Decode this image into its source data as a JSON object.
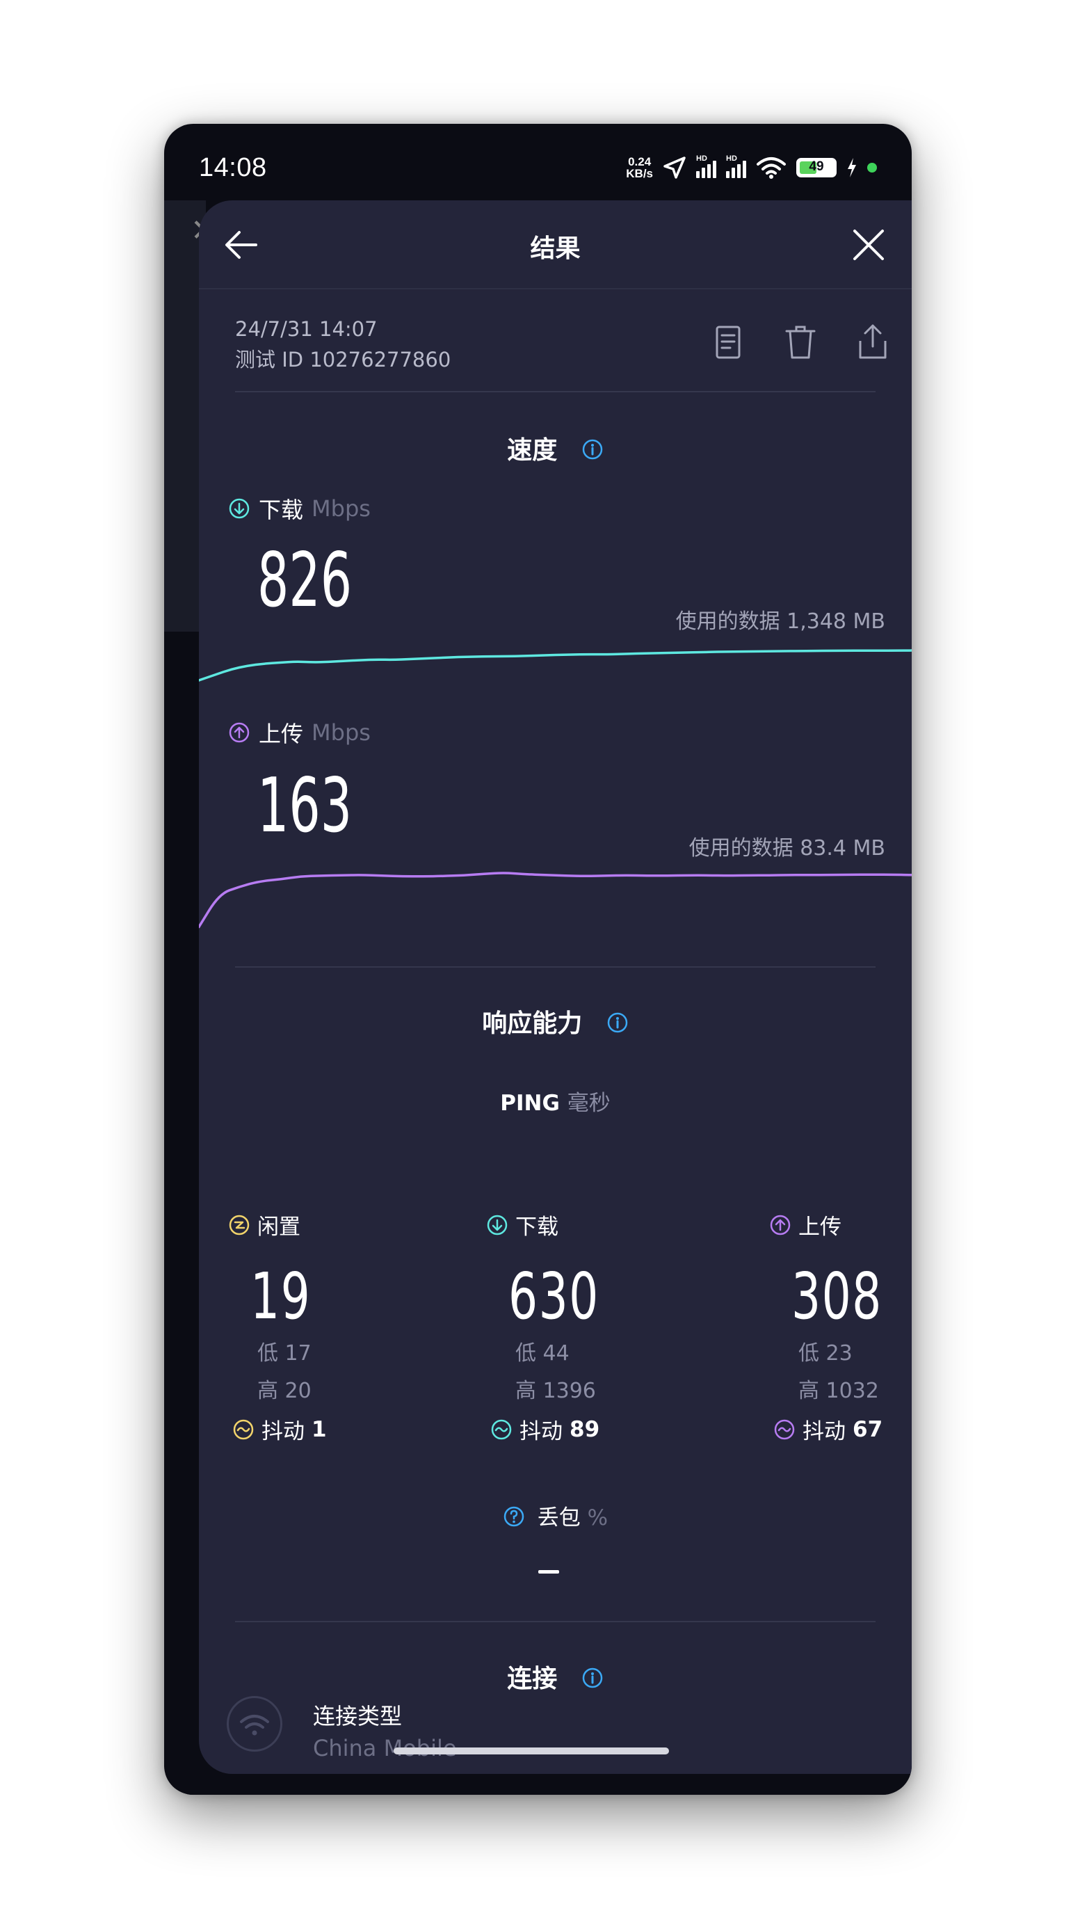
{
  "status_bar": {
    "time": "14:08",
    "net_speed_top": "0.24",
    "net_speed_bottom": "KB/s",
    "signal_badge": "HD",
    "battery": "49",
    "icons": [
      "location-arrow-icon",
      "signal-bars-icon",
      "wifi-icon",
      "battery-icon",
      "charging-icon"
    ]
  },
  "header": {
    "title": "结果",
    "back_icon": "arrow-left-icon",
    "close_icon": "close-icon"
  },
  "meta": {
    "date": "24/7/31 14:07",
    "test_id": "测试 ID 10276277860",
    "actions": [
      "document-icon",
      "trash-icon",
      "share-icon"
    ]
  },
  "speed": {
    "title": "速度",
    "download": {
      "label": "下载",
      "unit": "Mbps",
      "value": "826",
      "data_used": "使用的数据 1,348 MB",
      "color": "#5ee8e0"
    },
    "upload": {
      "label": "上传",
      "unit": "Mbps",
      "value": "163",
      "data_used": "使用的数据 83.4 MB",
      "color": "#b77cf2"
    }
  },
  "responsiveness": {
    "title": "响应能力",
    "ping_label": "PING",
    "ping_unit": "毫秒",
    "idle": {
      "label": "闲置",
      "value": "19",
      "low": "低 17",
      "high": "高 20",
      "jitter_label": "抖动",
      "jitter": "1",
      "color": "#f2d46b"
    },
    "download": {
      "label": "下载",
      "value": "630",
      "low": "低 44",
      "high": "高 1396",
      "jitter_label": "抖动",
      "jitter": "89",
      "color": "#5ee8e0"
    },
    "upload": {
      "label": "上传",
      "value": "308",
      "low": "低 23",
      "high": "高 1032",
      "jitter_label": "抖动",
      "jitter": "67",
      "color": "#b77cf2"
    }
  },
  "packet_loss": {
    "label": "丢包",
    "unit": "%",
    "value": "–"
  },
  "connection": {
    "title": "连接",
    "type_label": "连接类型",
    "type_value": "China Mobile"
  },
  "chart_data": [
    {
      "type": "line",
      "series": [
        {
          "values": [
            400,
            480,
            560,
            610,
            640,
            655,
            670,
            660,
            665,
            680,
            690,
            700,
            695,
            705,
            715,
            725,
            735,
            740,
            745,
            745,
            750,
            758,
            765,
            770,
            775,
            772,
            778,
            785,
            790,
            795,
            800,
            805,
            810,
            812,
            815,
            818,
            820,
            822,
            824,
            826,
            826,
            828,
            828,
            829,
            830
          ]
        }
      ],
      "ylim": [
        0,
        1000
      ]
    },
    {
      "type": "line",
      "series": [
        {
          "values": [
            20,
            110,
            130,
            145,
            150,
            158,
            160,
            161,
            162,
            160,
            158,
            158,
            159,
            161,
            165,
            168,
            164,
            162,
            160,
            159,
            160,
            161,
            160,
            160,
            161,
            161,
            160,
            161,
            161,
            162,
            162,
            162,
            163,
            163,
            163,
            162
          ]
        }
      ],
      "ylim": [
        0,
        190
      ]
    }
  ]
}
